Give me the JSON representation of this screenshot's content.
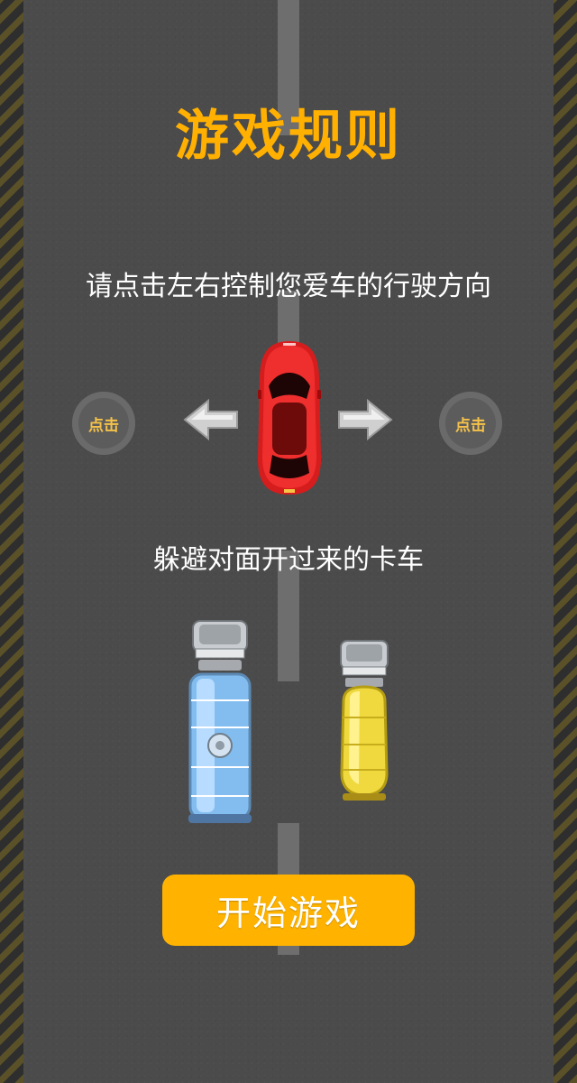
{
  "title": "游戏规则",
  "instructions": {
    "steer": "请点击左右控制您爱车的行驶方向",
    "avoid": "躲避对面开过来的卡车"
  },
  "controls": {
    "tap_left_label": "点击",
    "tap_right_label": "点击"
  },
  "start_button": {
    "label": "开始游戏"
  },
  "icons": {
    "left": "arrow-left-icon",
    "right": "arrow-right-icon",
    "player": "red-car-icon",
    "truck_1": "blue-tanker-truck-icon",
    "truck_2": "yellow-tanker-truck-icon"
  },
  "colors": {
    "accent": "#ffb300",
    "title": "#ffb000",
    "road": "#4b4b4b",
    "lane_mark": "#6e6e6e",
    "curb_stripe": "#5a5128"
  }
}
